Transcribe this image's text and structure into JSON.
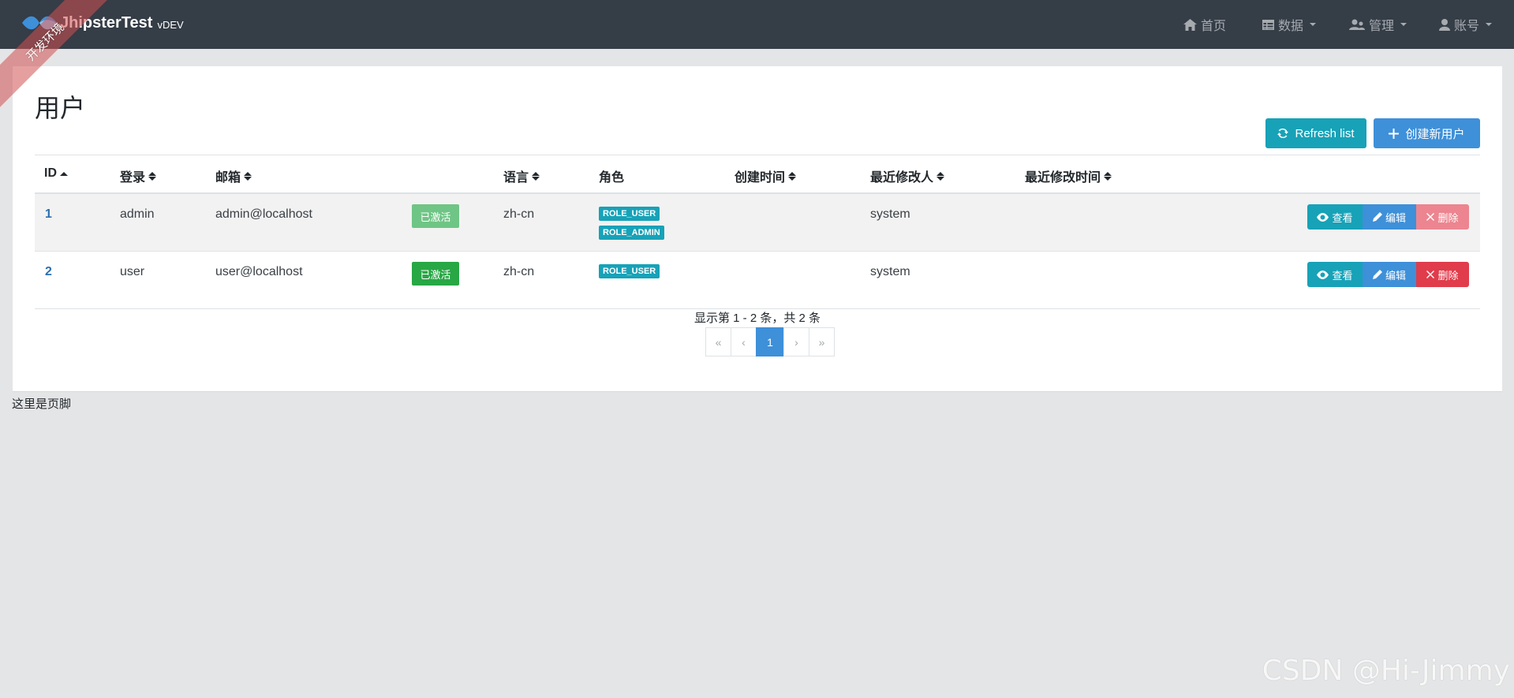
{
  "brand": {
    "name": "JhipsterTest",
    "version": "vDEV"
  },
  "ribbon": "开发环境",
  "nav": {
    "home": "首页",
    "data": "数据",
    "admin": "管理",
    "account": "账号"
  },
  "page": {
    "title": "用户",
    "refresh_label": "Refresh list",
    "create_label": "创建新用户"
  },
  "table": {
    "headers": {
      "id": "ID",
      "login": "登录",
      "email": "邮箱",
      "lang": "语言",
      "roles": "角色",
      "created": "创建时间",
      "modified_by": "最近修改人",
      "modified_date": "最近修改时间"
    },
    "rows": [
      {
        "id": "1",
        "login": "admin",
        "email": "admin@localhost",
        "status": "已激活",
        "lang": "zh-cn",
        "roles": [
          "ROLE_USER",
          "ROLE_ADMIN"
        ],
        "created": "",
        "modified_by": "system",
        "modified_date": ""
      },
      {
        "id": "2",
        "login": "user",
        "email": "user@localhost",
        "status": "已激活",
        "lang": "zh-cn",
        "roles": [
          "ROLE_USER"
        ],
        "created": "",
        "modified_by": "system",
        "modified_date": ""
      }
    ],
    "actions": {
      "view": "查看",
      "edit": "编辑",
      "delete": "删除"
    }
  },
  "pagination": {
    "summary": "显示第 1 - 2 条，共 2 条",
    "first": "«",
    "prev": "‹",
    "current": "1",
    "next": "›",
    "last": "»"
  },
  "footer": "这里是页脚",
  "watermark": "CSDN @Hi-Jimmy",
  "colors": {
    "navbar": "#353d47",
    "info": "#17a2b8",
    "primary": "#3e90d9",
    "danger": "#e03c4b",
    "success": "#28a745"
  }
}
